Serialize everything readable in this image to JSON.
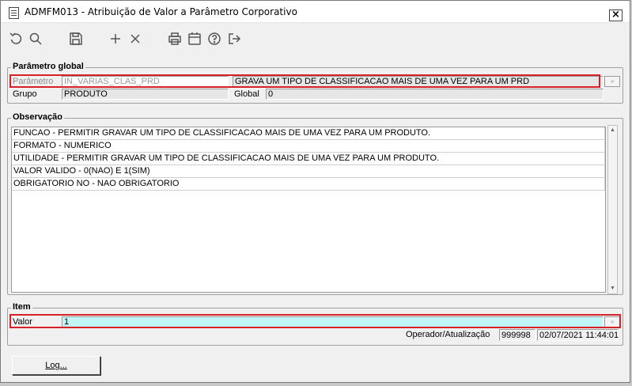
{
  "window": {
    "title": "ADMFM013 - Atribuição de Valor a Parâmetro Corporativo",
    "close_label": "×"
  },
  "toolbar": {
    "icons": [
      "undo-icon",
      "search-icon",
      "save-icon",
      "add-icon",
      "delete-icon",
      "print-icon",
      "calendar-icon",
      "help-icon",
      "exit-icon"
    ]
  },
  "parametro_global": {
    "title": "Parâmetro global",
    "parametro_label": "Parâmetro",
    "parametro_value": "IN_VARIAS_CLAS_PRD",
    "parametro_desc": "GRAVA UM TIPO DE CLASSIFICACAO MAIS DE UMA VEZ PARA UM PRD",
    "grupo_label": "Grupo",
    "grupo_value": "PRODUTO",
    "global_label": "Global",
    "global_value": "0",
    "lookup_label": "»"
  },
  "observacao": {
    "title": "Observação",
    "lines": [
      "FUNCAO -  PERMITIR GRAVAR UM TIPO DE CLASSIFICACAO MAIS DE UMA VEZ PARA UM PRODUTO.",
      "FORMATO - NUMERICO",
      "UTILIDADE - PERMITIR GRAVAR UM TIPO DE CLASSIFICACAO MAIS DE UMA VEZ PARA UM PRODUTO.",
      "VALOR VALIDO - 0(NAO) E 1(SIM)",
      "OBRIGATORIO NO - NAO OBRIGATORIO"
    ]
  },
  "item": {
    "title": "Item",
    "valor_label": "Valor",
    "valor_value": "1",
    "lookup_label": "»"
  },
  "status": {
    "operador_label": "Operador/Atualização",
    "operador_value": "999998",
    "data_value": "02/07/2021 11:44:01"
  },
  "log_button": {
    "label": "Log..."
  },
  "colors": {
    "highlight_outline": "#d82028",
    "valor_field_bg": "#c2f5f5",
    "readonly_bg": "#e6e6e6"
  }
}
